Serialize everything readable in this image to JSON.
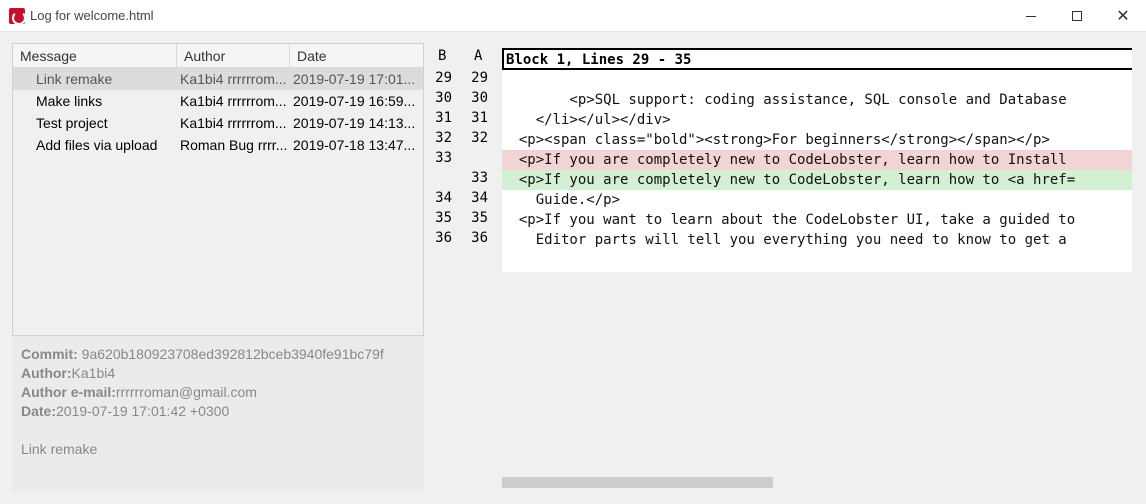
{
  "window": {
    "title": "Log for welcome.html"
  },
  "log": {
    "columns": [
      "Message",
      "Author",
      "Date"
    ],
    "rows": [
      {
        "message": "Link remake",
        "author": "Ka1bi4 rrrrrrom...",
        "date": "2019-07-19 17:01..."
      },
      {
        "message": "Make links",
        "author": "Ka1bi4 rrrrrrom...",
        "date": "2019-07-19 16:59..."
      },
      {
        "message": "Test project",
        "author": "Ka1bi4 rrrrrrom...",
        "date": "2019-07-19 14:13..."
      },
      {
        "message": "Add files via upload",
        "author": "Roman Bug rrrr...",
        "date": "2019-07-18 13:47..."
      }
    ],
    "selected_index": 0
  },
  "details": {
    "commit_label": "Commit:",
    "commit_value": " 9a620b180923708ed392812bceb3940fe91bc79f",
    "author_label": "Author:",
    "author_value": "Ka1bi4",
    "email_label": "Author e-mail:",
    "email_value": "rrrrrroman@gmail.com",
    "date_label": "Date:",
    "date_value": "2019-07-19 17:01:42 +0300",
    "message": "Link remake"
  },
  "diff": {
    "col_b": "B",
    "col_a": "A",
    "block_header": "Block 1, Lines 29 - 35",
    "gutter": [
      {
        "b": "29",
        "a": "29"
      },
      {
        "b": "30",
        "a": "30"
      },
      {
        "b": "31",
        "a": "31"
      },
      {
        "b": "32",
        "a": "32"
      },
      {
        "b": "33",
        "a": ""
      },
      {
        "b": "",
        "a": "33"
      },
      {
        "b": "34",
        "a": "34"
      },
      {
        "b": "35",
        "a": "35"
      },
      {
        "b": "36",
        "a": "36"
      }
    ],
    "lines": [
      {
        "text": "",
        "kind": "normal"
      },
      {
        "text": "        <p>SQL support: coding assistance, SQL console and Database",
        "kind": "normal"
      },
      {
        "text": "    </li></ul></div>",
        "kind": "normal"
      },
      {
        "text": "  <p><span class=\"bold\"><strong>For beginners</strong></span></p>",
        "kind": "normal"
      },
      {
        "text": "  <p>If you are completely new to CodeLobster, learn how to Install",
        "kind": "removed"
      },
      {
        "text": "  <p>If you are completely new to CodeLobster, learn how to <a href=",
        "kind": "added"
      },
      {
        "text": "    Guide.</p>",
        "kind": "normal"
      },
      {
        "text": "  <p>If you want to learn about the CodeLobster UI, take a guided to",
        "kind": "normal"
      },
      {
        "text": "    Editor parts will tell you everything you need to know to get a",
        "kind": "normal"
      }
    ]
  },
  "colors": {
    "removed_bg": "#f3d4d4",
    "added_bg": "#d4f0d4",
    "selected_row": "#dcdcdc"
  }
}
